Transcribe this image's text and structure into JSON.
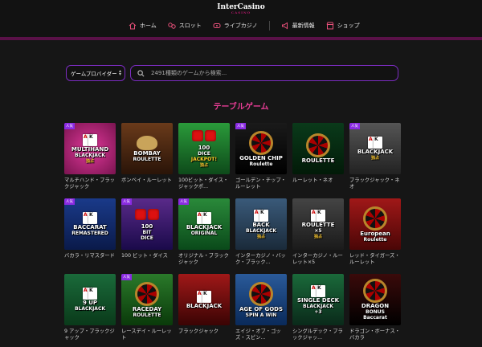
{
  "header": {
    "logo": "InterCasino",
    "logo_sub": "CASINO",
    "nav": [
      {
        "label": "ホーム",
        "icon": "home-icon"
      },
      {
        "label": "スロット",
        "icon": "slots-icon"
      },
      {
        "label": "ライブカジノ",
        "icon": "live-casino-icon"
      },
      {
        "label": "最新情報",
        "icon": "megaphone-icon"
      },
      {
        "label": "ショップ",
        "icon": "shop-icon"
      }
    ]
  },
  "filter": {
    "provider_label": "ゲームプロバイダー",
    "search_placeholder": "2491種類のゲームから検索..."
  },
  "section_title": "テーブルゲーム",
  "badge_new": "人気",
  "colors": {
    "accent": "#e83d95",
    "border": "#7b2cc0",
    "badge": "#8a2be2"
  },
  "games": [
    {
      "caption": "マルチハンド・ブラックジャック",
      "badge": true,
      "art": [
        "MULTIHAND",
        "BLACKJACK",
        "独占"
      ]
    },
    {
      "caption": "ボンベイ・ルーレット",
      "badge": false,
      "art": [
        "BOMBAY",
        "ROULETTE"
      ]
    },
    {
      "caption": "100ビット・ダイス・ジャックポ...",
      "badge": false,
      "art": [
        "100",
        "DICE",
        "JACKPOT!",
        "独占"
      ]
    },
    {
      "caption": "ゴールデン・チップ・ルーレット",
      "badge": true,
      "art": [
        "GOLDEN CHIP",
        "Roulette"
      ]
    },
    {
      "caption": "ルーレット・ネオ",
      "badge": false,
      "art": [
        "ROULETTE"
      ]
    },
    {
      "caption": "ブラックジャック・ネオ",
      "badge": true,
      "art": [
        "BLACKJACK",
        "独占"
      ]
    },
    {
      "caption": "バカラ・リマスタード",
      "badge": true,
      "art": [
        "BACCARAT",
        "REMASTERED"
      ]
    },
    {
      "caption": "100 ビット・ダイス",
      "badge": true,
      "art": [
        "100",
        "BIT",
        "DICE"
      ]
    },
    {
      "caption": "オリジナル・ブラックジャック",
      "badge": true,
      "art": [
        "BLACKJACK",
        "ORIGINAL"
      ]
    },
    {
      "caption": "インターカジノ・バック・ブラック...",
      "badge": false,
      "art": [
        "BACK",
        "BLACKJACK",
        "独占"
      ]
    },
    {
      "caption": "インターカジノ・ルーレット×5",
      "badge": false,
      "art": [
        "ROULETTE",
        "×5",
        "独占"
      ]
    },
    {
      "caption": "レッド・タイガーズ・ルーレット",
      "badge": false,
      "art": [
        "European",
        "Roulette"
      ]
    },
    {
      "caption": "9 アップ・ブラックジャック",
      "badge": false,
      "art": [
        "9 UP",
        "BLACKJACK"
      ]
    },
    {
      "caption": "レースデイ・ルーレット",
      "badge": true,
      "art": [
        "RACEDAY",
        "ROULETTE"
      ]
    },
    {
      "caption": "ブラックジャック",
      "badge": false,
      "art": [
        "BLACKJACK"
      ]
    },
    {
      "caption": "エイジ・オブ・ゴッズ・スピン...",
      "badge": false,
      "art": [
        "AGE OF GODS",
        "SPIN A WIN"
      ]
    },
    {
      "caption": "シングルデック・ブラックジャッ...",
      "badge": false,
      "art": [
        "SINGLE DECK",
        "BLACKJACK",
        "+3"
      ]
    },
    {
      "caption": "ドラゴン・ボーナス・バカラ",
      "badge": false,
      "art": [
        "DRAGON",
        "BONUS",
        "Baccarat"
      ]
    }
  ]
}
